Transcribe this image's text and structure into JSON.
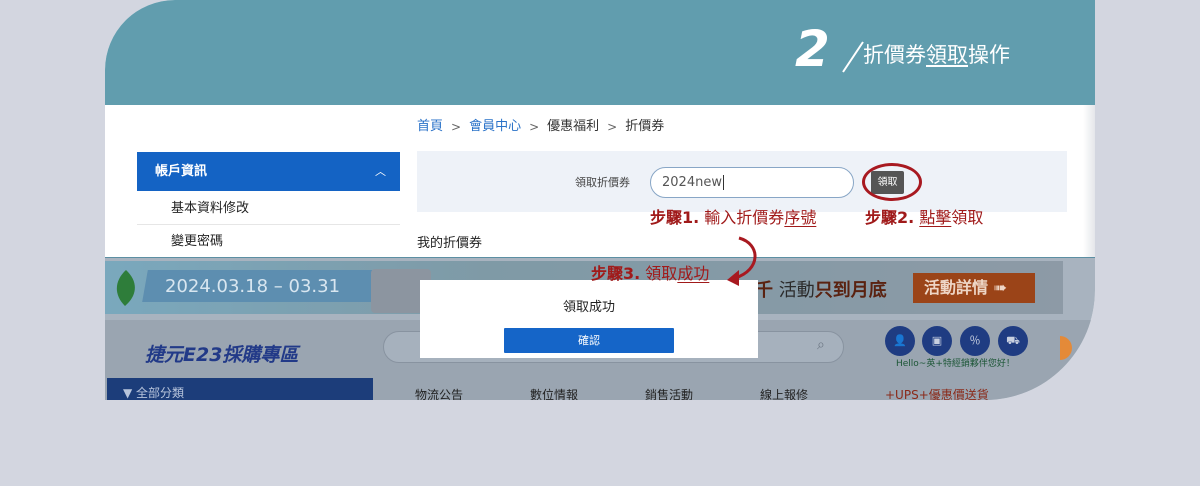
{
  "header": {
    "step_number": "2",
    "title_part1": "折價券",
    "title_underlined": "領取",
    "title_part2": "操作"
  },
  "breadcrumb": {
    "home": "首頁",
    "member": "會員中心",
    "benefits": "優惠福利",
    "current": "折價券"
  },
  "sidebar": {
    "section_title": "帳戶資訊",
    "items": [
      {
        "label": "基本資料修改"
      },
      {
        "label": "變更密碼"
      }
    ]
  },
  "form": {
    "label": "領取折價券",
    "input_value": "2024new",
    "claim_button": "領取"
  },
  "annotations": {
    "step1_prefix": "步驟1.",
    "step1_text": " 輸入折價券",
    "step1_underlined": "序號",
    "step2_prefix": "步驟2.",
    "step2_sp": " ",
    "step2_underlined": "點擊",
    "step2_text": "領取",
    "step3_prefix": "步驟3.",
    "step3_text": " 領取",
    "step3_underlined": "成功"
  },
  "my_coupons_title": "我的折價券",
  "modal": {
    "message": "領取成功",
    "confirm_button": "確認"
  },
  "background_site": {
    "banner_date": "2024.03.18 – 03.31",
    "banner_suffix": "千",
    "banner_text1": " 活動",
    "banner_text2": "只到月底",
    "banner_button": "活動詳情 ➠",
    "logo": "捷元E23採購專區",
    "hello": "Hello~英+特經銷夥伴您好！",
    "category": "▼ 全部分類",
    "nav_items": [
      "物流公告",
      "數位情報",
      "銷售活動",
      "線上報修",
      "+UPS+優惠價送貨"
    ]
  },
  "colors": {
    "header_band": "#619dae",
    "primary_blue": "#1463c4",
    "annotation_red": "#a01a1a",
    "background": "#d3d6e0"
  }
}
